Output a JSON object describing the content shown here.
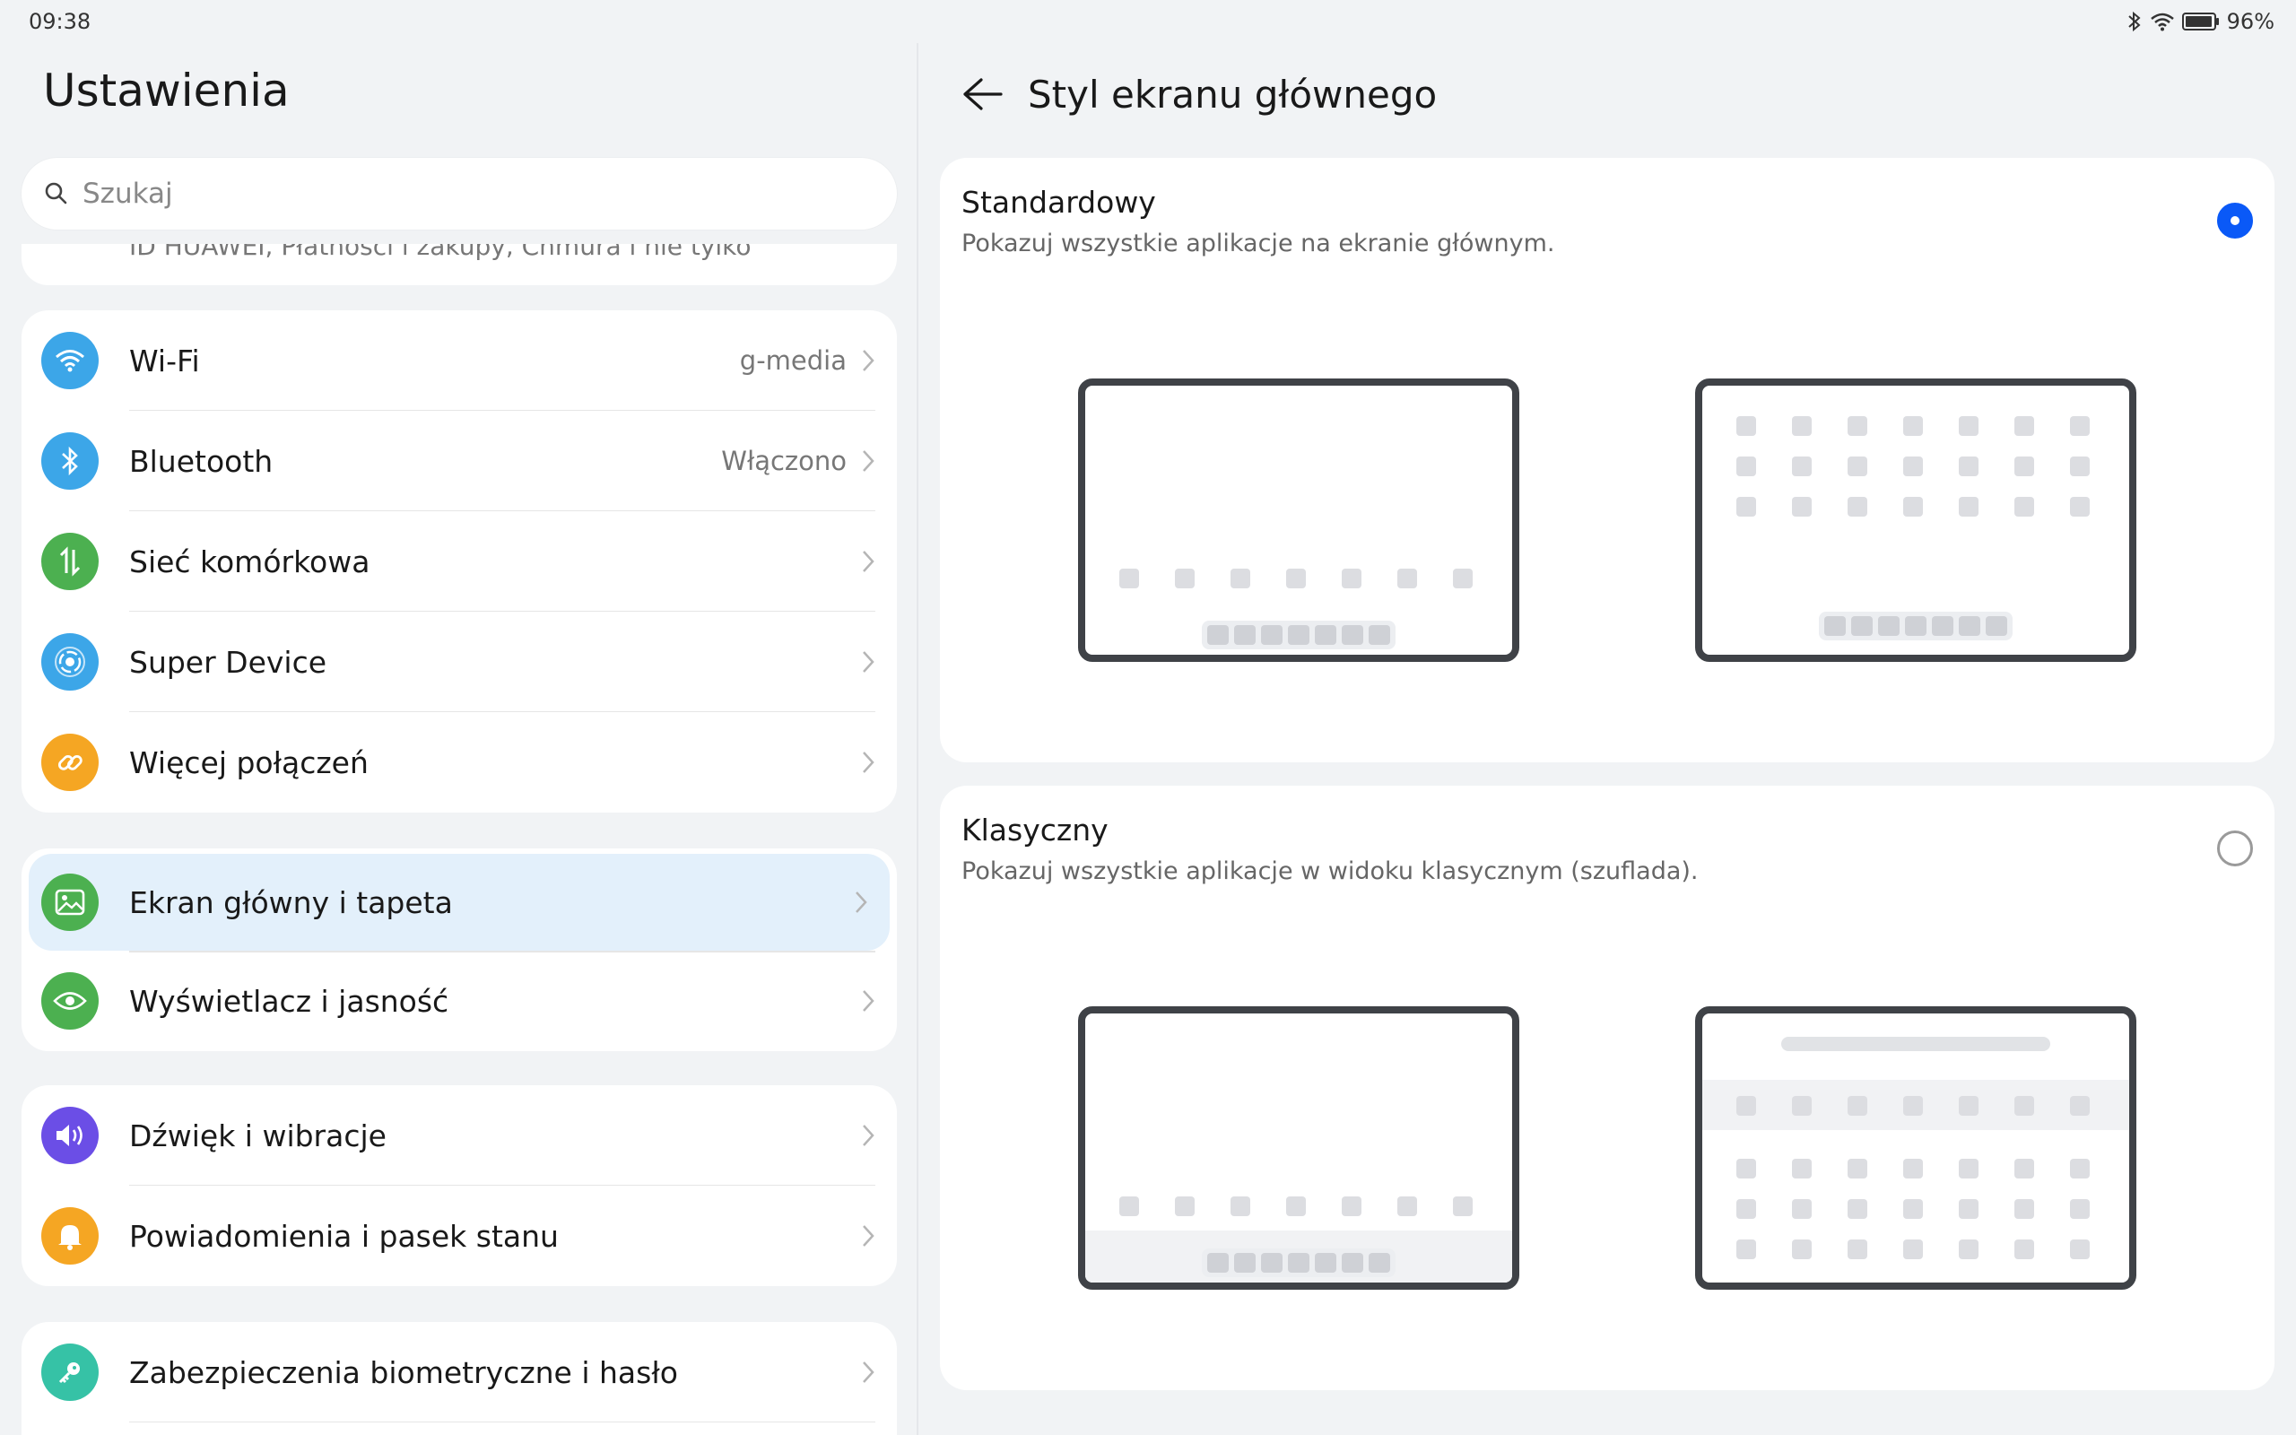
{
  "status": {
    "time": "09:38",
    "battery": "96%",
    "icons": [
      "bluetooth-icon",
      "wifi-icon",
      "battery-icon"
    ]
  },
  "left": {
    "title": "Ustawienia",
    "search_placeholder": "Szukaj",
    "peek_text": "ID HUAWEI, Płatności i zakupy, Chmura i nie tylko",
    "groups": [
      {
        "items": [
          {
            "label": "Wi-Fi",
            "value": "g-media",
            "icon": "wifi-icon",
            "color": "#3ca6e8"
          },
          {
            "label": "Bluetooth",
            "value": "Włączono",
            "icon": "bluetooth-icon",
            "color": "#3ca6e8"
          },
          {
            "label": "Sieć komórkowa",
            "value": "",
            "icon": "cellular-icon",
            "color": "#4cb050"
          },
          {
            "label": "Super Device",
            "value": "",
            "icon": "super-device-icon",
            "color": "#3ca6e8"
          },
          {
            "label": "Więcej połączeń",
            "value": "",
            "icon": "link-icon",
            "color": "#f5a623"
          }
        ]
      },
      {
        "items": [
          {
            "label": "Ekran główny i tapeta",
            "value": "",
            "icon": "wallpaper-icon",
            "color": "#4cb050",
            "selected": true
          },
          {
            "label": "Wyświetlacz i jasność",
            "value": "",
            "icon": "eye-icon",
            "color": "#4cb050"
          }
        ]
      },
      {
        "items": [
          {
            "label": "Dźwięk i wibracje",
            "value": "",
            "icon": "speaker-icon",
            "color": "#6b4ee6"
          },
          {
            "label": "Powiadomienia i pasek stanu",
            "value": "",
            "icon": "bell-icon",
            "color": "#f5a623"
          }
        ]
      },
      {
        "items": [
          {
            "label": "Zabezpieczenia biometryczne i hasło",
            "value": "",
            "icon": "key-icon",
            "color": "#36c2a6"
          }
        ]
      }
    ]
  },
  "right": {
    "title": "Styl ekranu głównego",
    "options": [
      {
        "title": "Standardowy",
        "desc": "Pokazuj wszystkie aplikacje na ekranie głównym.",
        "selected": true
      },
      {
        "title": "Klasyczny",
        "desc": "Pokazuj wszystkie aplikacje w widoku klasycznym (szuflada).",
        "selected": false
      }
    ]
  },
  "colors": {
    "accent": "#0a59f7",
    "selected_row": "#e3f0fb"
  }
}
